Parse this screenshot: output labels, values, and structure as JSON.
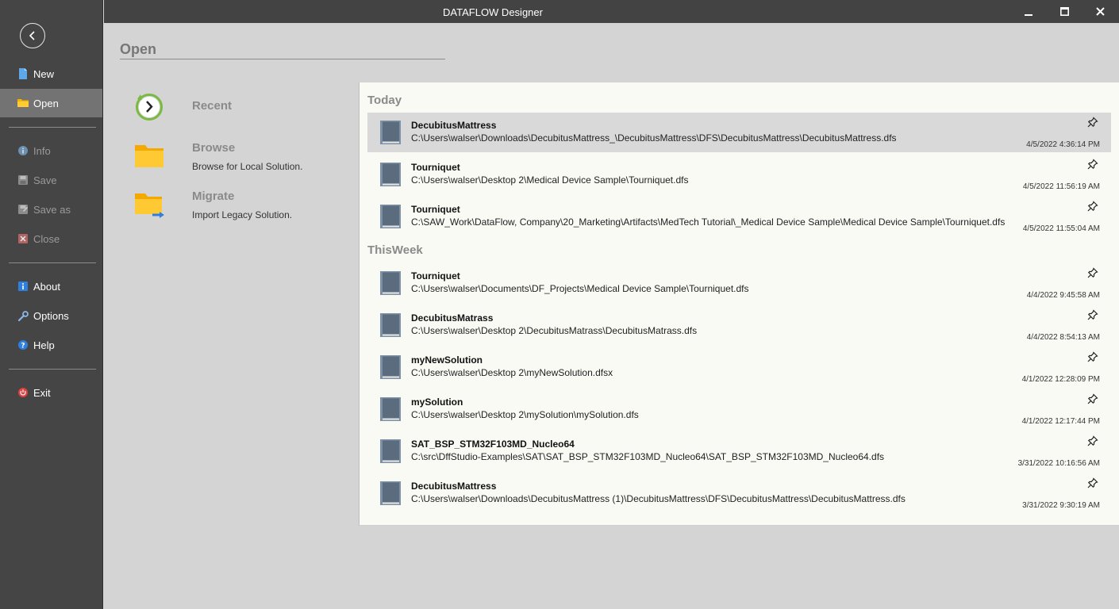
{
  "window": {
    "title": "DATAFLOW Designer",
    "controls": [
      "minimize-icon",
      "maximize-icon",
      "close-icon"
    ]
  },
  "sidebar": {
    "back_icon": "back-arrow-icon",
    "items": [
      {
        "id": "new",
        "label": "New",
        "icon": "new-file-icon",
        "enabled": true
      },
      {
        "id": "open",
        "label": "Open",
        "icon": "folder-icon",
        "enabled": true,
        "active": true
      },
      {
        "id": "info",
        "label": "Info",
        "icon": "info-icon",
        "enabled": false
      },
      {
        "id": "save",
        "label": "Save",
        "icon": "save-icon",
        "enabled": false
      },
      {
        "id": "save-as",
        "label": "Save as",
        "icon": "save-as-icon",
        "enabled": false
      },
      {
        "id": "close",
        "label": "Close",
        "icon": "close-icon",
        "enabled": false
      },
      {
        "id": "about",
        "label": "About",
        "icon": "about-icon",
        "enabled": true
      },
      {
        "id": "options",
        "label": "Options",
        "icon": "wrench-icon",
        "enabled": true
      },
      {
        "id": "help",
        "label": "Help",
        "icon": "help-icon",
        "enabled": true
      },
      {
        "id": "exit",
        "label": "Exit",
        "icon": "power-icon",
        "enabled": true
      }
    ]
  },
  "page": {
    "heading": "Open",
    "actions": [
      {
        "title": "Recent",
        "subtitle": "",
        "icon": "recent-icon"
      },
      {
        "title": "Browse",
        "subtitle": "Browse for Local Solution.",
        "icon": "folder-icon"
      },
      {
        "title": "Migrate",
        "subtitle": "Import Legacy Solution.",
        "icon": "folder-import-icon"
      }
    ]
  },
  "recent": {
    "groups": [
      {
        "title": "Today",
        "files": [
          {
            "name": "DecubitusMattress",
            "path": "C:\\Users\\walser\\Downloads\\DecubitusMattress_\\DecubitusMattress\\DFS\\DecubitusMattress\\DecubitusMattress.dfs",
            "date": "4/5/2022 4:36:14 PM",
            "selected": true
          },
          {
            "name": "Tourniquet",
            "path": "C:\\Users\\walser\\Desktop 2\\Medical Device Sample\\Tourniquet.dfs",
            "date": "4/5/2022 11:56:19 AM"
          },
          {
            "name": "Tourniquet",
            "path": "C:\\SAW_Work\\DataFlow, Company\\20_Marketing\\Artifacts\\MedTech Tutorial\\_Medical Device Sample\\Medical Device Sample\\Tourniquet.dfs",
            "date": "4/5/2022 11:55:04 AM"
          }
        ]
      },
      {
        "title": "ThisWeek",
        "files": [
          {
            "name": "Tourniquet",
            "path": "C:\\Users\\walser\\Documents\\DF_Projects\\Medical Device Sample\\Tourniquet.dfs",
            "date": "4/4/2022 9:45:58 AM"
          },
          {
            "name": "DecubitusMatrass",
            "path": "C:\\Users\\walser\\Desktop 2\\DecubitusMatrass\\DecubitusMatrass.dfs",
            "date": "4/4/2022 8:54:13 AM"
          },
          {
            "name": "myNewSolution",
            "path": "C:\\Users\\walser\\Desktop 2\\myNewSolution.dfsx",
            "date": "4/1/2022 12:28:09 PM"
          },
          {
            "name": "mySolution",
            "path": "C:\\Users\\walser\\Desktop 2\\mySolution\\mySolution.dfs",
            "date": "4/1/2022 12:17:44 PM"
          },
          {
            "name": "SAT_BSP_STM32F103MD_Nucleo64",
            "path": "C:\\src\\DffStudio-Examples\\SAT\\SAT_BSP_STM32F103MD_Nucleo64\\SAT_BSP_STM32F103MD_Nucleo64.dfs",
            "date": "3/31/2022 10:16:56 AM"
          },
          {
            "name": "DecubitusMattress",
            "path": "C:\\Users\\walser\\Downloads\\DecubitusMattress (1)\\DecubitusMattress\\DFS\\DecubitusMattress\\DecubitusMattress.dfs",
            "date": "3/31/2022 9:30:19 AM"
          }
        ]
      }
    ]
  }
}
